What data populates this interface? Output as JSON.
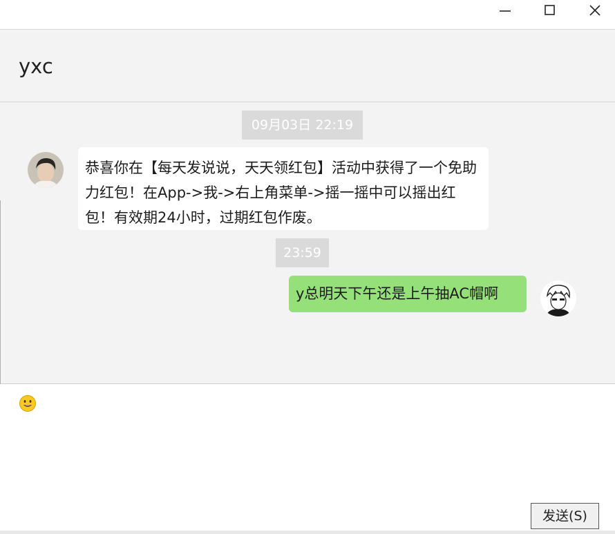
{
  "window": {
    "minimize_icon": "minimize-icon",
    "maximize_icon": "maximize-icon",
    "close_icon": "close-icon"
  },
  "header": {
    "contact_name": "yxc"
  },
  "messages": [
    {
      "timestamp": "09月03日 22:19",
      "direction": "incoming",
      "text": "恭喜你在【每天发说说，天天领红包】活动中获得了一个免助力红包！在App->我->右上角菜单->摇一摇中可以摇出红包！有效期24小时，过期红包作废。"
    },
    {
      "timestamp": "23:59",
      "direction": "outgoing",
      "text": "y总明天下午还是上午抽AC帽啊"
    }
  ],
  "composer": {
    "emoji_icon": "smiley-emoji-icon",
    "send_label": "发送(S)",
    "input_value": ""
  },
  "colors": {
    "chat_background": "#f3f3f3",
    "incoming_bubble": "#ffffff",
    "outgoing_bubble": "#96e07a",
    "timestamp_badge": "#dadada"
  }
}
